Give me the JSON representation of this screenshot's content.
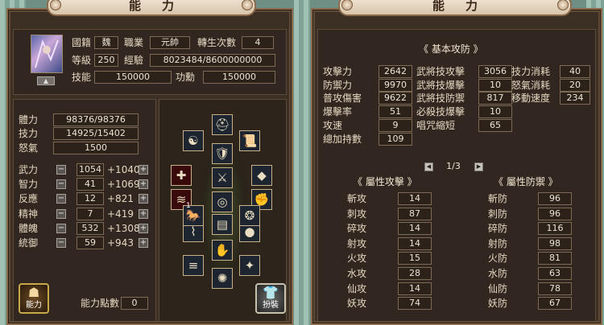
{
  "left": {
    "title": "能力",
    "profile": {
      "nation_label": "國籍",
      "nation_value": "魏",
      "job_label": "職業",
      "job_value": "元帥",
      "reborn_label": "轉生次數",
      "reborn_value": "4",
      "level_label": "等級",
      "level_value": "250",
      "exp_label": "經驗",
      "exp_value": "8023484/8600000000",
      "skill_label": "技能",
      "skill_value": "150000",
      "merit_label": "功勳",
      "merit_value": "150000"
    },
    "vitals": {
      "hp_label": "體力",
      "hp_value": "98376/98376",
      "sp_label": "技力",
      "sp_value": "14925/15402",
      "rage_label": "怒氣",
      "rage_value": "1500"
    },
    "stats": [
      {
        "label": "武力",
        "value": "1054",
        "bonus": "+1040"
      },
      {
        "label": "智力",
        "value": "41",
        "bonus": "+1069"
      },
      {
        "label": "反應",
        "value": "12",
        "bonus": "+821"
      },
      {
        "label": "精神",
        "value": "7",
        "bonus": "+419"
      },
      {
        "label": "體魄",
        "value": "532",
        "bonus": "+1308"
      },
      {
        "label": "統御",
        "value": "59",
        "bonus": "+943"
      }
    ],
    "points_label": "能力點數",
    "points_value": "0",
    "ability_btn": "能力",
    "outfit_btn": "扮裝",
    "minus": "−",
    "plus": "+",
    "equip_badge": "1"
  },
  "right": {
    "title": "能力",
    "basic_header": "《 基本攻防 》",
    "basic_rows": [
      [
        {
          "label": "攻擊力",
          "value": "2642"
        },
        {
          "label": "武將技攻擊",
          "value": "3056"
        },
        {
          "label": "技力消耗",
          "value": "40"
        }
      ],
      [
        {
          "label": "防禦力",
          "value": "9970"
        },
        {
          "label": "武將技爆擊",
          "value": "10"
        },
        {
          "label": "怒氣消耗",
          "value": "20"
        }
      ],
      [
        {
          "label": "普攻傷害",
          "value": "9622"
        },
        {
          "label": "武將技防禦",
          "value": "817"
        },
        {
          "label": "移動速度",
          "value": "234"
        }
      ],
      [
        {
          "label": "爆擊率",
          "value": "51"
        },
        {
          "label": "必殺技爆擊",
          "value": "10"
        }
      ],
      [
        {
          "label": "攻速",
          "value": "9"
        },
        {
          "label": "唱咒縮短",
          "value": "65"
        }
      ],
      [
        {
          "label": "總加持數",
          "value": "109"
        }
      ]
    ],
    "page": "1/3",
    "attack_header": "《 屬性攻擊 》",
    "defense_header": "《 屬性防禦 》",
    "attack": [
      {
        "label": "斬攻",
        "value": "14"
      },
      {
        "label": "刺攻",
        "value": "87"
      },
      {
        "label": "碎攻",
        "value": "14"
      },
      {
        "label": "射攻",
        "value": "14"
      },
      {
        "label": "火攻",
        "value": "15"
      },
      {
        "label": "水攻",
        "value": "28"
      },
      {
        "label": "仙攻",
        "value": "14"
      },
      {
        "label": "妖攻",
        "value": "74"
      }
    ],
    "defense": [
      {
        "label": "斬防",
        "value": "96"
      },
      {
        "label": "刺防",
        "value": "96"
      },
      {
        "label": "碎防",
        "value": "116"
      },
      {
        "label": "射防",
        "value": "98"
      },
      {
        "label": "火防",
        "value": "81"
      },
      {
        "label": "水防",
        "value": "63"
      },
      {
        "label": "仙防",
        "value": "78"
      },
      {
        "label": "妖防",
        "value": "67"
      }
    ]
  },
  "equipment_icons": [
    "helmet-icon",
    "yin-yang-icon",
    "scroll-icon",
    "armor-icon",
    "crossbow-icon",
    "shield-icon",
    "sword-icon",
    "cape-icon",
    "fist-icon",
    "ring-icon",
    "belt-icon",
    "bracer-icon",
    "orb-icon",
    "gauntlet-icon",
    "boots-icon",
    "amulet-icon",
    "dagger-icon",
    "mount-icon",
    "necklace-icon"
  ],
  "colors": {
    "panel": "#3c2f24",
    "value_box": "#2c221a",
    "title_bg": "#e8dcc8"
  }
}
